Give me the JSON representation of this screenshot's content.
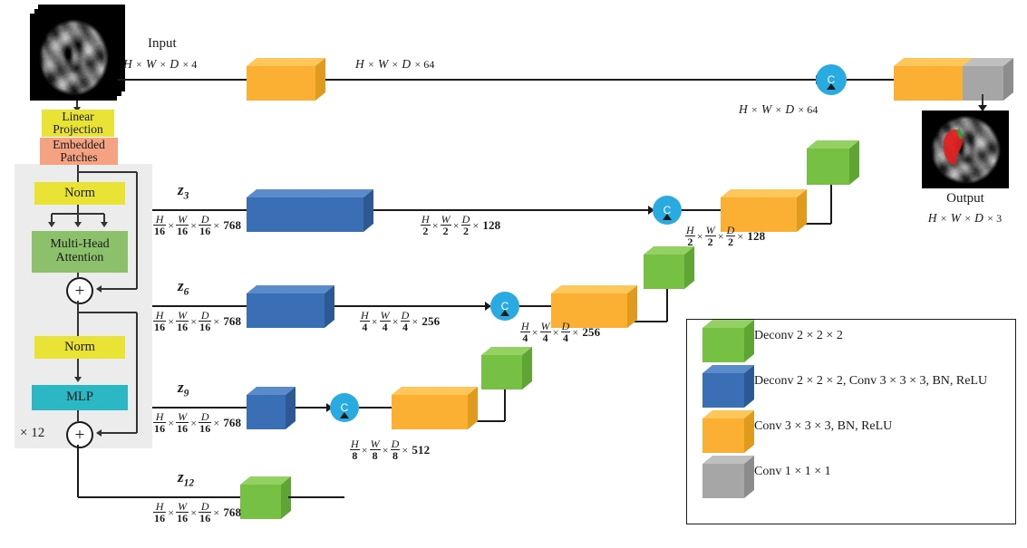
{
  "diagram": {
    "title": "UNETR architecture",
    "colors": {
      "orange": "#FBB034",
      "orange_top": "#FFC75A",
      "orange_side": "#E09A1E",
      "blue": "#3A6FB5",
      "blue_top": "#5A8BCB",
      "blue_side": "#2C5994",
      "green": "#76C043",
      "green_top": "#93D162",
      "green_side": "#5EA534",
      "gray": "#A6A6A6",
      "gray_top": "#BFBFBF",
      "gray_side": "#8C8C8C",
      "yellow": "#E8E335",
      "salmon": "#F5A283",
      "attention_green": "#8CC06A",
      "mlp_cyan": "#2BB8C4",
      "panel_gray": "#ECECEC",
      "concat_blue": "#29ABE2",
      "line": "#1A1A1A"
    }
  },
  "input": {
    "label": "Input",
    "dims": {
      "h": "H",
      "w": "W",
      "d": "D",
      "c": "4"
    }
  },
  "output": {
    "label": "Output",
    "dims": {
      "h": "H",
      "w": "W",
      "d": "D",
      "c": "3"
    }
  },
  "transformer": {
    "linear_projection": "Linear\nProjection",
    "linear_projection_l1": "Linear",
    "linear_projection_l2": "Projection",
    "embedded_patches_l1": "Embedded",
    "embedded_patches_l2": "Patches",
    "norm1": "Norm",
    "attention_l1": "Multi-Head",
    "attention_l2": "Attention",
    "norm2": "Norm",
    "mlp": "MLP",
    "plus1": "+",
    "plus2": "+",
    "repeat": "× 12"
  },
  "skip_labels": [
    {
      "name": "z3",
      "text": "z",
      "sub": "3"
    },
    {
      "name": "z6",
      "text": "z",
      "sub": "6"
    },
    {
      "name": "z9",
      "text": "z",
      "sub": "9"
    },
    {
      "name": "z12",
      "text": "z",
      "sub": "12"
    }
  ],
  "dimension_labels": {
    "input_hwd4": {
      "style": "plain",
      "h": "H",
      "w": "W",
      "d": "D",
      "c": "4"
    },
    "top_hwd64": {
      "style": "plain",
      "h": "H",
      "w": "W",
      "d": "D",
      "c": "64"
    },
    "skipup_hwd64": {
      "style": "plain",
      "h": "H",
      "w": "W",
      "d": "D",
      "c": "64"
    },
    "z3_in": {
      "style": "frac",
      "den": "16",
      "c": "768"
    },
    "z3_out": {
      "style": "frac",
      "den": "2",
      "c": "128"
    },
    "z6_in": {
      "style": "frac",
      "den": "16",
      "c": "768"
    },
    "z6_out": {
      "style": "frac",
      "den": "4",
      "c": "256"
    },
    "z9_in": {
      "style": "frac",
      "den": "16",
      "c": "768"
    },
    "z12_in": {
      "style": "frac",
      "den": "16",
      "c": "768"
    },
    "dec8_512": {
      "style": "frac",
      "den": "8",
      "c": "512"
    },
    "dec4_256": {
      "style": "frac",
      "den": "4",
      "c": "256"
    },
    "dec2_128": {
      "style": "frac",
      "den": "2",
      "c": "128"
    }
  },
  "concat_nodes": [
    {
      "name": "concat-top",
      "label": "C"
    },
    {
      "name": "concat-z3",
      "label": "C"
    },
    {
      "name": "concat-z6",
      "label": "C"
    },
    {
      "name": "concat-z9",
      "label": "C"
    }
  ],
  "legend": {
    "items": [
      {
        "color": "green",
        "label": "Deconv 2 × 2 × 2"
      },
      {
        "color": "blue",
        "label": "Deconv 2 × 2 × 2,  Conv 3 × 3 × 3, BN, ReLU"
      },
      {
        "color": "orange",
        "label": "Conv 3 × 3 × 3, BN, ReLU"
      },
      {
        "color": "gray",
        "label": "Conv 1 × 1 × 1"
      }
    ]
  }
}
